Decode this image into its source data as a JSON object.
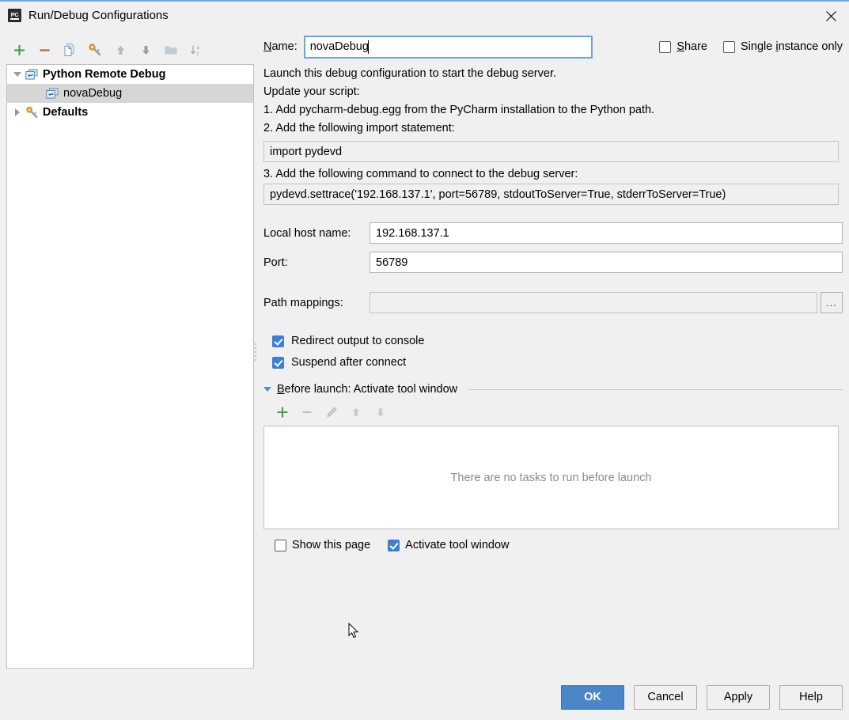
{
  "window": {
    "title": "Run/Debug Configurations",
    "app_icon": "pycharm-icon",
    "close_icon": "close-icon"
  },
  "left_panel": {
    "toolbar": [
      {
        "name": "add-configuration-button",
        "icon": "plus-icon",
        "glyph": "+",
        "color": "#4a9e4a",
        "enabled": true
      },
      {
        "name": "remove-configuration-button",
        "icon": "minus-icon",
        "glyph": "–",
        "color": "#c9524c",
        "enabled": true
      },
      {
        "name": "copy-configuration-button",
        "icon": "copy-icon",
        "glyph": "⧉",
        "color": "#6b9dc6",
        "enabled": true
      },
      {
        "name": "edit-defaults-button",
        "icon": "wrench-gear-icon",
        "glyph": "⚒",
        "color": "#b8892e",
        "enabled": true
      },
      {
        "name": "move-up-button",
        "icon": "arrow-up-icon",
        "glyph": "↑",
        "color": "#b4b4b4",
        "enabled": false
      },
      {
        "name": "move-down-button",
        "icon": "arrow-down-icon",
        "glyph": "↓",
        "color": "#b4b4b4",
        "enabled": false
      },
      {
        "name": "move-into-folder-button",
        "icon": "folder-icon",
        "glyph": "▬",
        "color": "#b4b4b4",
        "enabled": false
      },
      {
        "name": "sort-configurations-button",
        "icon": "sort-alpha-icon",
        "glyph": "⇣",
        "color": "#8fa8c0",
        "enabled": false
      }
    ],
    "tree": [
      {
        "label": "Python Remote Debug",
        "icon": "remote-debug-icon",
        "bold": true,
        "expanded": true,
        "level": 0,
        "selected": false,
        "has_arrow": true
      },
      {
        "label": "novaDebug",
        "icon": "remote-debug-icon",
        "bold": false,
        "expanded": false,
        "level": 1,
        "selected": true,
        "has_arrow": false
      },
      {
        "label": "Defaults",
        "icon": "wrench-gear-icon",
        "bold": true,
        "expanded": false,
        "level": 0,
        "selected": false,
        "has_arrow": true
      }
    ]
  },
  "form": {
    "name_label": "Name:",
    "name_label_mnemonic": "N",
    "name_value": "novaDebug",
    "share": {
      "label": "Share",
      "mnemonic": "S",
      "checked": false
    },
    "single_instance": {
      "label": "Single instance only",
      "mnemonic": "i",
      "checked": false
    },
    "description": [
      "Launch this debug configuration to start the debug server.",
      "Update your script:",
      "1. Add pycharm-debug.egg from the PyCharm installation to the Python path.",
      "2. Add the following import statement:"
    ],
    "import_statement": "import pydevd",
    "step3_label": "3. Add the following command to connect to the debug server:",
    "settrace_command": "pydevd.settrace('192.168.137.1', port=56789, stdoutToServer=True, stderrToServer=True)",
    "local_host_name": {
      "label": "Local host name:",
      "value": "192.168.137.1"
    },
    "port": {
      "label": "Port:",
      "value": "56789"
    },
    "path_mappings": {
      "label": "Path mappings:",
      "value": "",
      "browse_label": "..."
    },
    "redirect_output": {
      "label": "Redirect output to console",
      "checked": true
    },
    "suspend_after_connect": {
      "label": "Suspend after connect",
      "checked": true
    }
  },
  "before_launch": {
    "header": "Before launch: Activate tool window",
    "header_mnemonic": "B",
    "expanded": true,
    "toolbar": [
      {
        "name": "add-task-button",
        "icon": "plus-icon",
        "glyph": "+",
        "color": "#4a9e4a",
        "enabled": true
      },
      {
        "name": "remove-task-button",
        "icon": "minus-icon",
        "glyph": "–",
        "color": "#bdbdbd",
        "enabled": false
      },
      {
        "name": "edit-task-button",
        "icon": "pencil-icon",
        "glyph": "✎",
        "color": "#bdbdbd",
        "enabled": false
      },
      {
        "name": "task-move-up-button",
        "icon": "arrow-up-icon",
        "glyph": "↑",
        "color": "#bdbdbd",
        "enabled": false
      },
      {
        "name": "task-move-down-button",
        "icon": "arrow-down-icon",
        "glyph": "↓",
        "color": "#bdbdbd",
        "enabled": false
      }
    ],
    "empty_text": "There are no tasks to run before launch",
    "show_this_page": {
      "label": "Show this page",
      "checked": false
    },
    "activate_tool_window": {
      "label": "Activate tool window",
      "checked": true
    }
  },
  "buttons": [
    {
      "name": "ok-button",
      "label": "OK",
      "primary": true
    },
    {
      "name": "cancel-button",
      "label": "Cancel",
      "primary": false
    },
    {
      "name": "apply-button",
      "label": "Apply",
      "primary": false
    },
    {
      "name": "help-button",
      "label": "Help",
      "primary": false
    }
  ],
  "colors": {
    "accent": "#4a86c8",
    "checkbox_checked": "#3d7fd4",
    "dialog_bg": "#f0f0f0",
    "selection": "#d6d6d6",
    "title_accent": "#6fa8dc"
  }
}
